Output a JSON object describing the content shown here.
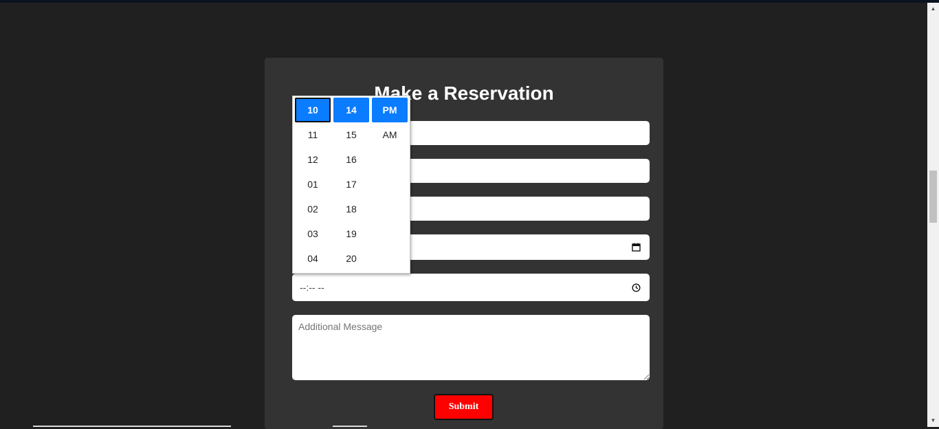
{
  "form": {
    "title": "Make a Reservation",
    "date_icon": "calendar-icon",
    "time_value": "--:-- --",
    "time_icon": "clock-icon",
    "message_placeholder": "Additional Message",
    "submit_label": "Submit",
    "submit_color": "#ff0000"
  },
  "time_picker": {
    "accent_color": "#0a7cff",
    "hours": [
      "10",
      "11",
      "12",
      "01",
      "02",
      "03",
      "04"
    ],
    "minutes": [
      "14",
      "15",
      "16",
      "17",
      "18",
      "19",
      "20"
    ],
    "periods": [
      "PM",
      "AM"
    ],
    "selected_hour": "10",
    "selected_minute": "14",
    "selected_period": "PM"
  }
}
